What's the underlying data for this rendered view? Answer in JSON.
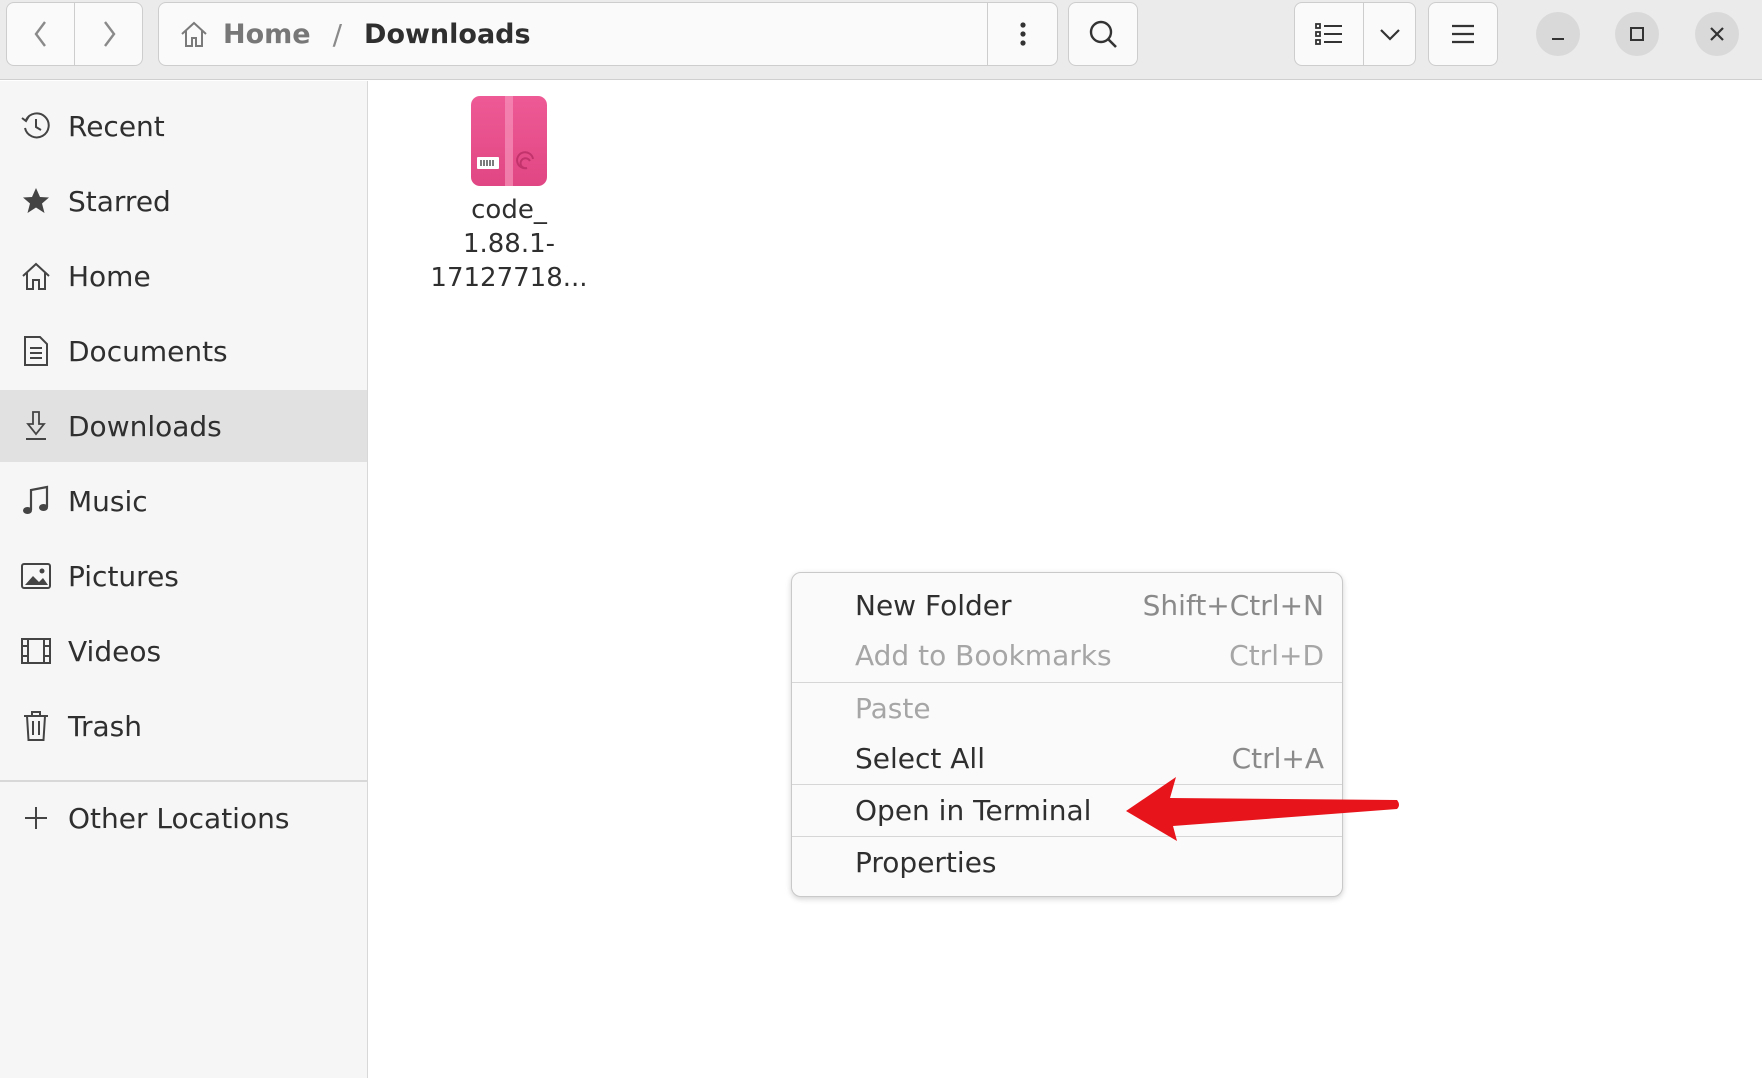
{
  "header": {
    "back_icon": "chevron-left-icon",
    "forward_icon": "chevron-right-icon",
    "breadcrumb": {
      "home_label": "Home",
      "separator": "/",
      "current_label": "Downloads"
    },
    "path_menu_icon": "vertical-ellipsis-icon",
    "search_icon": "search-icon",
    "view_list_icon": "list-view-icon",
    "view_options_icon": "chevron-down-icon",
    "main_menu_icon": "hamburger-menu-icon",
    "window_controls": [
      "minimize-icon",
      "maximize-icon",
      "close-icon"
    ]
  },
  "sidebar": {
    "items": [
      {
        "label": "Recent",
        "icon": "clock-icon"
      },
      {
        "label": "Starred",
        "icon": "star-icon"
      },
      {
        "label": "Home",
        "icon": "home-icon"
      },
      {
        "label": "Documents",
        "icon": "document-icon"
      },
      {
        "label": "Downloads",
        "icon": "download-icon",
        "active": true
      },
      {
        "label": "Music",
        "icon": "music-note-icon"
      },
      {
        "label": "Pictures",
        "icon": "picture-icon"
      },
      {
        "label": "Videos",
        "icon": "film-icon"
      },
      {
        "label": "Trash",
        "icon": "trash-icon"
      }
    ],
    "other_locations": {
      "label": "Other Locations",
      "icon": "plus-icon"
    }
  },
  "files": [
    {
      "name_lines": [
        "code_",
        "1.88.1-",
        "17127718..."
      ],
      "icon": "debian-package-icon",
      "icon_color": "#e8508a"
    }
  ],
  "context_menu": {
    "items": [
      {
        "label": "New Folder",
        "shortcut": "Shift+Ctrl+N",
        "enabled": true
      },
      {
        "label": "Add to Bookmarks",
        "shortcut": "Ctrl+D",
        "enabled": false
      },
      {
        "label": "Paste",
        "shortcut": "",
        "enabled": false
      },
      {
        "label": "Select All",
        "shortcut": "Ctrl+A",
        "enabled": true
      },
      {
        "label": "Open in Terminal",
        "shortcut": "",
        "enabled": true
      },
      {
        "label": "Properties",
        "shortcut": "",
        "enabled": true
      }
    ]
  },
  "annotation": {
    "arrow_color": "#e8141b",
    "points_to": "Open in Terminal"
  }
}
